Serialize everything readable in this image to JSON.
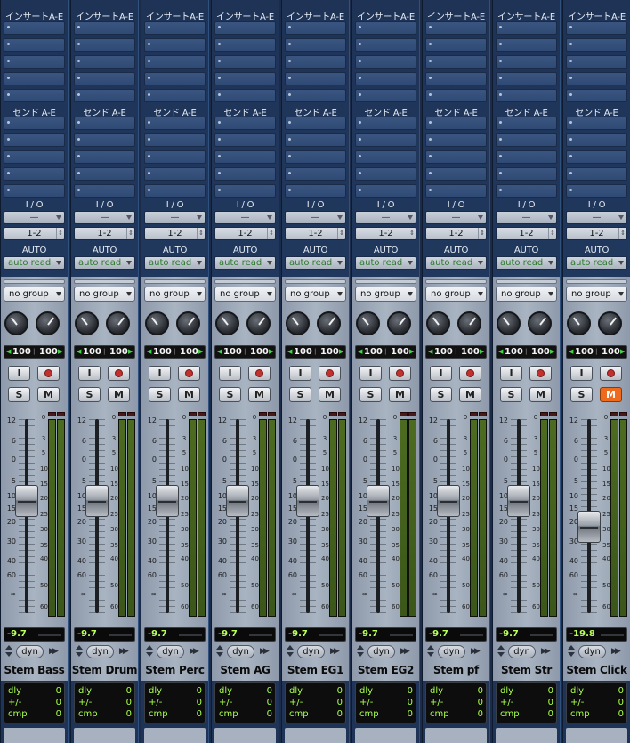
{
  "labels": {
    "inserts": "インサートA-E",
    "sends": "センド A-E",
    "io": "I / O",
    "io_input": "—",
    "auto": "AUTO",
    "group": "no group",
    "input_btn": "I",
    "solo_btn": "S",
    "mute_btn": "M",
    "dyn": "dyn",
    "dyn_arrows": "▶▶",
    "delay_row_labels": [
      "dly",
      "+/-",
      "cmp"
    ]
  },
  "scale_marks": [
    "12",
    "6",
    "0",
    "5",
    "10",
    "15",
    "20",
    "30",
    "40",
    "60",
    "∞"
  ],
  "meter_marks": [
    "0",
    "3",
    "5",
    "10",
    "15",
    "20",
    "25",
    "30",
    "35",
    "40",
    "50",
    "60"
  ],
  "colors": {
    "strip_bg": "#233b63",
    "lower_bg": "#a9b4c2",
    "meter_led": "#37e637",
    "volume_text": "#b8ff5a",
    "mute_on": "#ee6a1e",
    "automation_text": "#2b7a2b"
  },
  "channels": [
    {
      "name": "Stem Bass",
      "io_output": "1-2",
      "automation": "auto read",
      "pan_left": "100",
      "pan_right": "100",
      "volume": "-9.7",
      "mute": false,
      "volume_db": -9.7,
      "delay": {
        "dly": "0",
        "plusminus": "0",
        "cmp": "0"
      }
    },
    {
      "name": "Stem Drum",
      "io_output": "1-2",
      "automation": "auto read",
      "pan_left": "100",
      "pan_right": "100",
      "volume": "-9.7",
      "mute": false,
      "volume_db": -9.7,
      "delay": {
        "dly": "0",
        "plusminus": "0",
        "cmp": "0"
      }
    },
    {
      "name": "Stem Perc",
      "io_output": "1-2",
      "automation": "auto read",
      "pan_left": "100",
      "pan_right": "100",
      "volume": "-9.7",
      "mute": false,
      "volume_db": -9.7,
      "delay": {
        "dly": "0",
        "plusminus": "0",
        "cmp": "0"
      }
    },
    {
      "name": "Stem AG",
      "io_output": "1-2",
      "automation": "auto read",
      "pan_left": "100",
      "pan_right": "100",
      "volume": "-9.7",
      "mute": false,
      "volume_db": -9.7,
      "delay": {
        "dly": "0",
        "plusminus": "0",
        "cmp": "0"
      }
    },
    {
      "name": "Stem EG1",
      "io_output": "1-2",
      "automation": "auto read",
      "pan_left": "100",
      "pan_right": "100",
      "volume": "-9.7",
      "mute": false,
      "volume_db": -9.7,
      "delay": {
        "dly": "0",
        "plusminus": "0",
        "cmp": "0"
      }
    },
    {
      "name": "Stem EG2",
      "io_output": "1-2",
      "automation": "auto read",
      "pan_left": "100",
      "pan_right": "100",
      "volume": "-9.7",
      "mute": false,
      "volume_db": -9.7,
      "delay": {
        "dly": "0",
        "plusminus": "0",
        "cmp": "0"
      }
    },
    {
      "name": "Stem pf",
      "io_output": "1-2",
      "automation": "auto read",
      "pan_left": "100",
      "pan_right": "100",
      "volume": "-9.7",
      "mute": false,
      "volume_db": -9.7,
      "delay": {
        "dly": "0",
        "plusminus": "0",
        "cmp": "0"
      }
    },
    {
      "name": "Stem Str",
      "io_output": "1-2",
      "automation": "auto read",
      "pan_left": "100",
      "pan_right": "100",
      "volume": "-9.7",
      "mute": false,
      "volume_db": -9.7,
      "delay": {
        "dly": "0",
        "plusminus": "0",
        "cmp": "0"
      }
    },
    {
      "name": "Stem Click",
      "io_output": "1-2",
      "automation": "auto read",
      "pan_left": "100",
      "pan_right": "100",
      "volume": "-19.8",
      "mute": true,
      "volume_db": -19.8,
      "delay": {
        "dly": "0",
        "plusminus": "0",
        "cmp": "0"
      }
    }
  ]
}
